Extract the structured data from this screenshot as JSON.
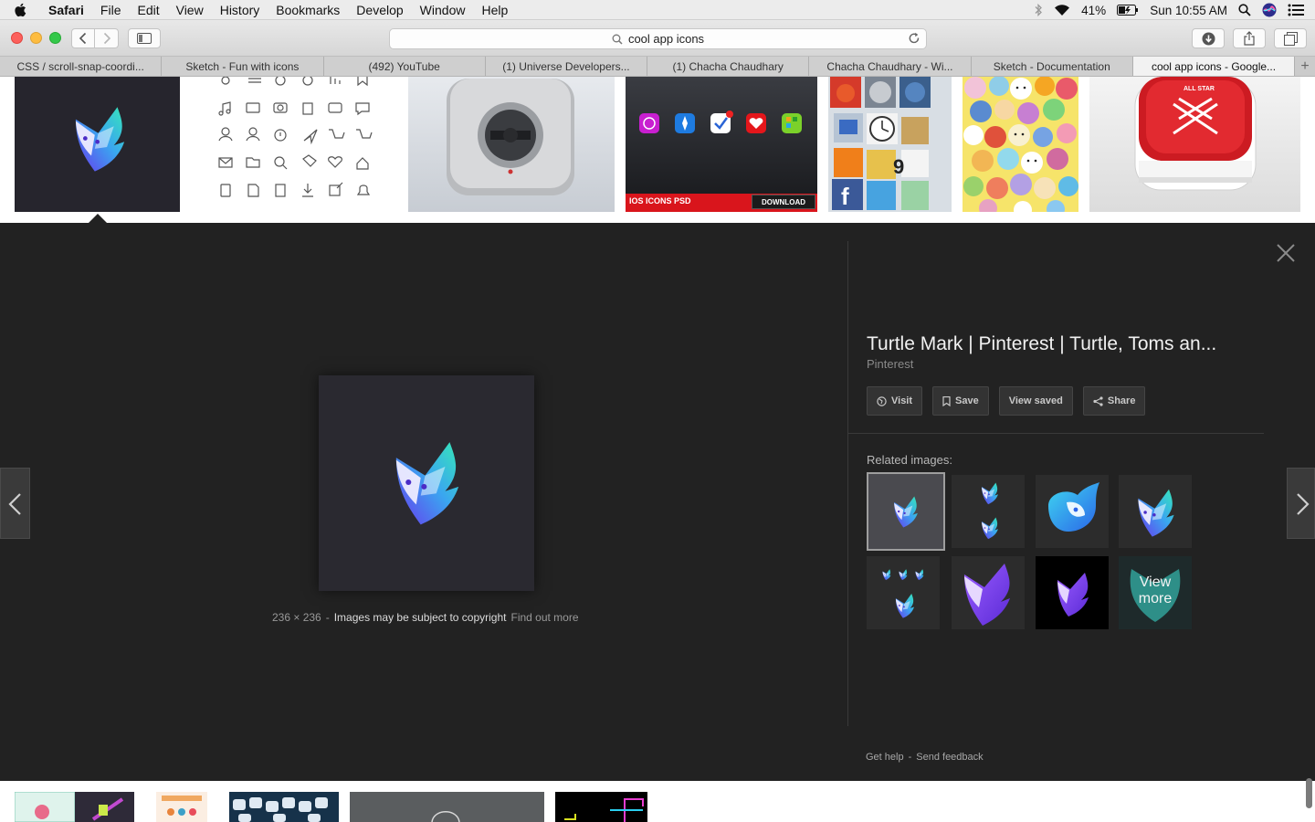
{
  "menubar": {
    "app": "Safari",
    "items": [
      "File",
      "Edit",
      "View",
      "History",
      "Bookmarks",
      "Develop",
      "Window",
      "Help"
    ],
    "battery": "41%",
    "clock": "Sun 10:55 AM"
  },
  "address": {
    "query": "cool app icons"
  },
  "tabs": [
    "CSS / scroll-snap-coordi...",
    "Sketch - Fun with icons",
    "(492) YouTube",
    "(1) Universe Developers...",
    "(1) Chacha Chaudhary",
    "Chacha Chaudhary - Wi...",
    "Sketch - Documentation",
    "cool app icons - Google..."
  ],
  "active_tab_index": 7,
  "thumbnails": {
    "ios_psd_label": "IOS ICONS PSD",
    "download_label": "DOWNLOAD",
    "converse_label": "ALL STAR",
    "clock_number": "9"
  },
  "preview": {
    "dimensions": "236 × 236",
    "separator": "-",
    "copyright": "Images may be subject to copyright",
    "find_out_more": "Find out more"
  },
  "info": {
    "title": "Turtle Mark | Pinterest | Turtle, Toms an...",
    "source": "Pinterest",
    "actions": {
      "visit": "Visit",
      "save": "Save",
      "view_saved": "View saved",
      "share": "Share"
    },
    "related_label": "Related images:",
    "view_more_line1": "View",
    "view_more_line2": "more"
  },
  "footer": {
    "help": "Get help",
    "separator": "-",
    "feedback": "Send feedback"
  },
  "colors": {
    "panel_bg": "#222222",
    "close_red": "#fc605c",
    "minimize_yellow": "#fdbc40",
    "zoom_green": "#34c84a",
    "logo_cyan": "#3ee6c4",
    "logo_purple": "#7a3cf0"
  }
}
